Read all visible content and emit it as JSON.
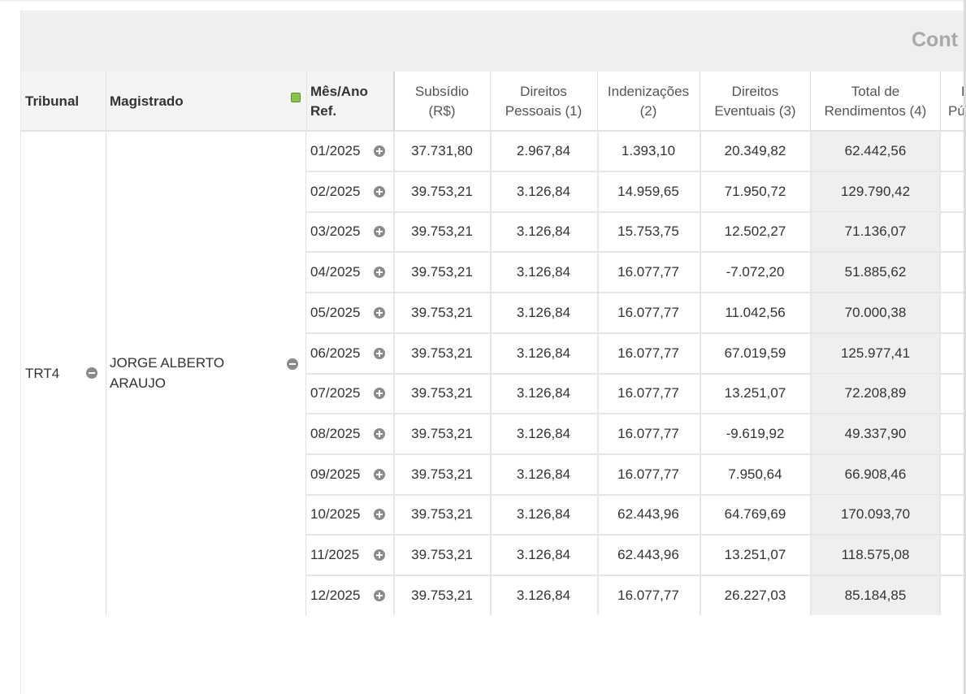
{
  "group_header": {
    "title": "Cont"
  },
  "header": {
    "tribunal": "Tribunal",
    "magistrado": "Magistrado",
    "mes_ano_line1": "Mês/Ano",
    "mes_ano_line2": "Ref.",
    "subsidio_line1": "Subsídio",
    "subsidio_line2": "(R$)",
    "direitos_pessoais_line1": "Direitos",
    "direitos_pessoais_line2": "Pessoais (1)",
    "indenizacoes_line1": "Indenizações",
    "indenizacoes_line2": "(2)",
    "direitos_eventuais_line1": "Direitos",
    "direitos_eventuais_line2": "Eventuais (3)",
    "total_line1": "Total de",
    "total_line2": "Rendimentos (4)",
    "next_col_line1": "F",
    "next_col_line2": "Pú"
  },
  "record": {
    "tribunal": "TRT4",
    "magistrado": "JORGE ALBERTO ARAUJO"
  },
  "rows": [
    {
      "month": "01/2025",
      "subsidio": "37.731,80",
      "pessoais": "2.967,84",
      "indenizacoes": "1.393,10",
      "eventuais": "20.349,82",
      "total": "62.442,56"
    },
    {
      "month": "02/2025",
      "subsidio": "39.753,21",
      "pessoais": "3.126,84",
      "indenizacoes": "14.959,65",
      "eventuais": "71.950,72",
      "total": "129.790,42"
    },
    {
      "month": "03/2025",
      "subsidio": "39.753,21",
      "pessoais": "3.126,84",
      "indenizacoes": "15.753,75",
      "eventuais": "12.502,27",
      "total": "71.136,07"
    },
    {
      "month": "04/2025",
      "subsidio": "39.753,21",
      "pessoais": "3.126,84",
      "indenizacoes": "16.077,77",
      "eventuais": "-7.072,20",
      "total": "51.885,62"
    },
    {
      "month": "05/2025",
      "subsidio": "39.753,21",
      "pessoais": "3.126,84",
      "indenizacoes": "16.077,77",
      "eventuais": "11.042,56",
      "total": "70.000,38"
    },
    {
      "month": "06/2025",
      "subsidio": "39.753,21",
      "pessoais": "3.126,84",
      "indenizacoes": "16.077,77",
      "eventuais": "67.019,59",
      "total": "125.977,41"
    },
    {
      "month": "07/2025",
      "subsidio": "39.753,21",
      "pessoais": "3.126,84",
      "indenizacoes": "16.077,77",
      "eventuais": "13.251,07",
      "total": "72.208,89"
    },
    {
      "month": "08/2025",
      "subsidio": "39.753,21",
      "pessoais": "3.126,84",
      "indenizacoes": "16.077,77",
      "eventuais": "-9.619,92",
      "total": "49.337,90"
    },
    {
      "month": "09/2025",
      "subsidio": "39.753,21",
      "pessoais": "3.126,84",
      "indenizacoes": "16.077,77",
      "eventuais": "7.950,64",
      "total": "66.908,46"
    },
    {
      "month": "10/2025",
      "subsidio": "39.753,21",
      "pessoais": "3.126,84",
      "indenizacoes": "62.443,96",
      "eventuais": "64.769,69",
      "total": "170.093,70"
    },
    {
      "month": "11/2025",
      "subsidio": "39.753,21",
      "pessoais": "3.126,84",
      "indenizacoes": "62.443,96",
      "eventuais": "13.251,07",
      "total": "118.575,08"
    },
    {
      "month": "12/2025",
      "subsidio": "39.753,21",
      "pessoais": "3.126,84",
      "indenizacoes": "16.077,77",
      "eventuais": "26.227,03",
      "total": "85.184,85"
    }
  ],
  "icons": {
    "collapse": "minus-circle-icon",
    "expand": "plus-circle-icon",
    "legend": "green-square-icon"
  },
  "colors": {
    "legend_green": "#8bc34a",
    "total_column_bg": "#efefef",
    "group_header_bg": "#efefef"
  }
}
